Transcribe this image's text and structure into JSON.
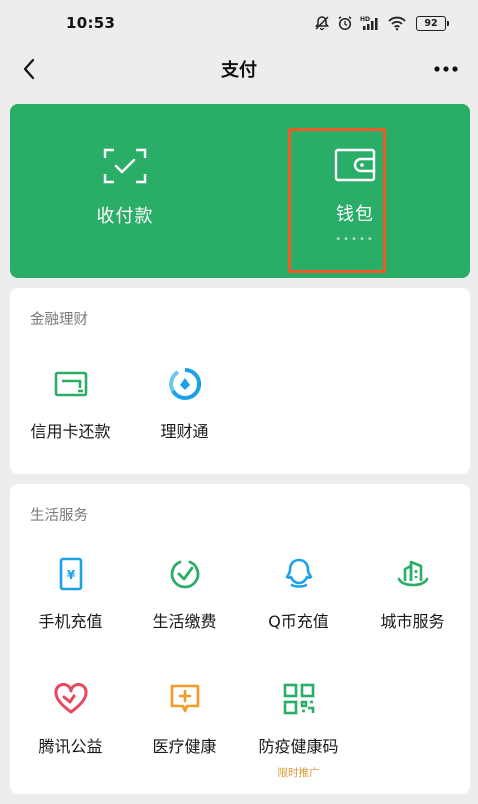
{
  "status_bar": {
    "time": "10:53",
    "battery": "92"
  },
  "nav": {
    "title": "支付"
  },
  "pay_card": {
    "receive_label": "收付款",
    "wallet_label": "钱包",
    "wallet_dots": "•••••"
  },
  "finance": {
    "title": "金融理财",
    "items": [
      {
        "label": "信用卡还款",
        "icon": "credit-card-repay-icon"
      },
      {
        "label": "理财通",
        "icon": "wealth-icon"
      }
    ]
  },
  "life": {
    "title": "生活服务",
    "items": [
      {
        "label": "手机充值",
        "icon": "phone-topup-icon"
      },
      {
        "label": "生活缴费",
        "icon": "utility-bill-icon"
      },
      {
        "label": "Q币充值",
        "icon": "qq-coin-icon"
      },
      {
        "label": "城市服务",
        "icon": "city-service-icon"
      },
      {
        "label": "腾讯公益",
        "icon": "charity-icon"
      },
      {
        "label": "医疗健康",
        "icon": "medical-icon"
      },
      {
        "label": "防疫健康码",
        "icon": "health-code-icon",
        "badge": "限时推广"
      }
    ]
  },
  "colors": {
    "accent": "#2aae67",
    "highlight": "#f05a2a",
    "blue": "#1aa1e6",
    "red": "#e8495f",
    "orange": "#f39a2b"
  }
}
